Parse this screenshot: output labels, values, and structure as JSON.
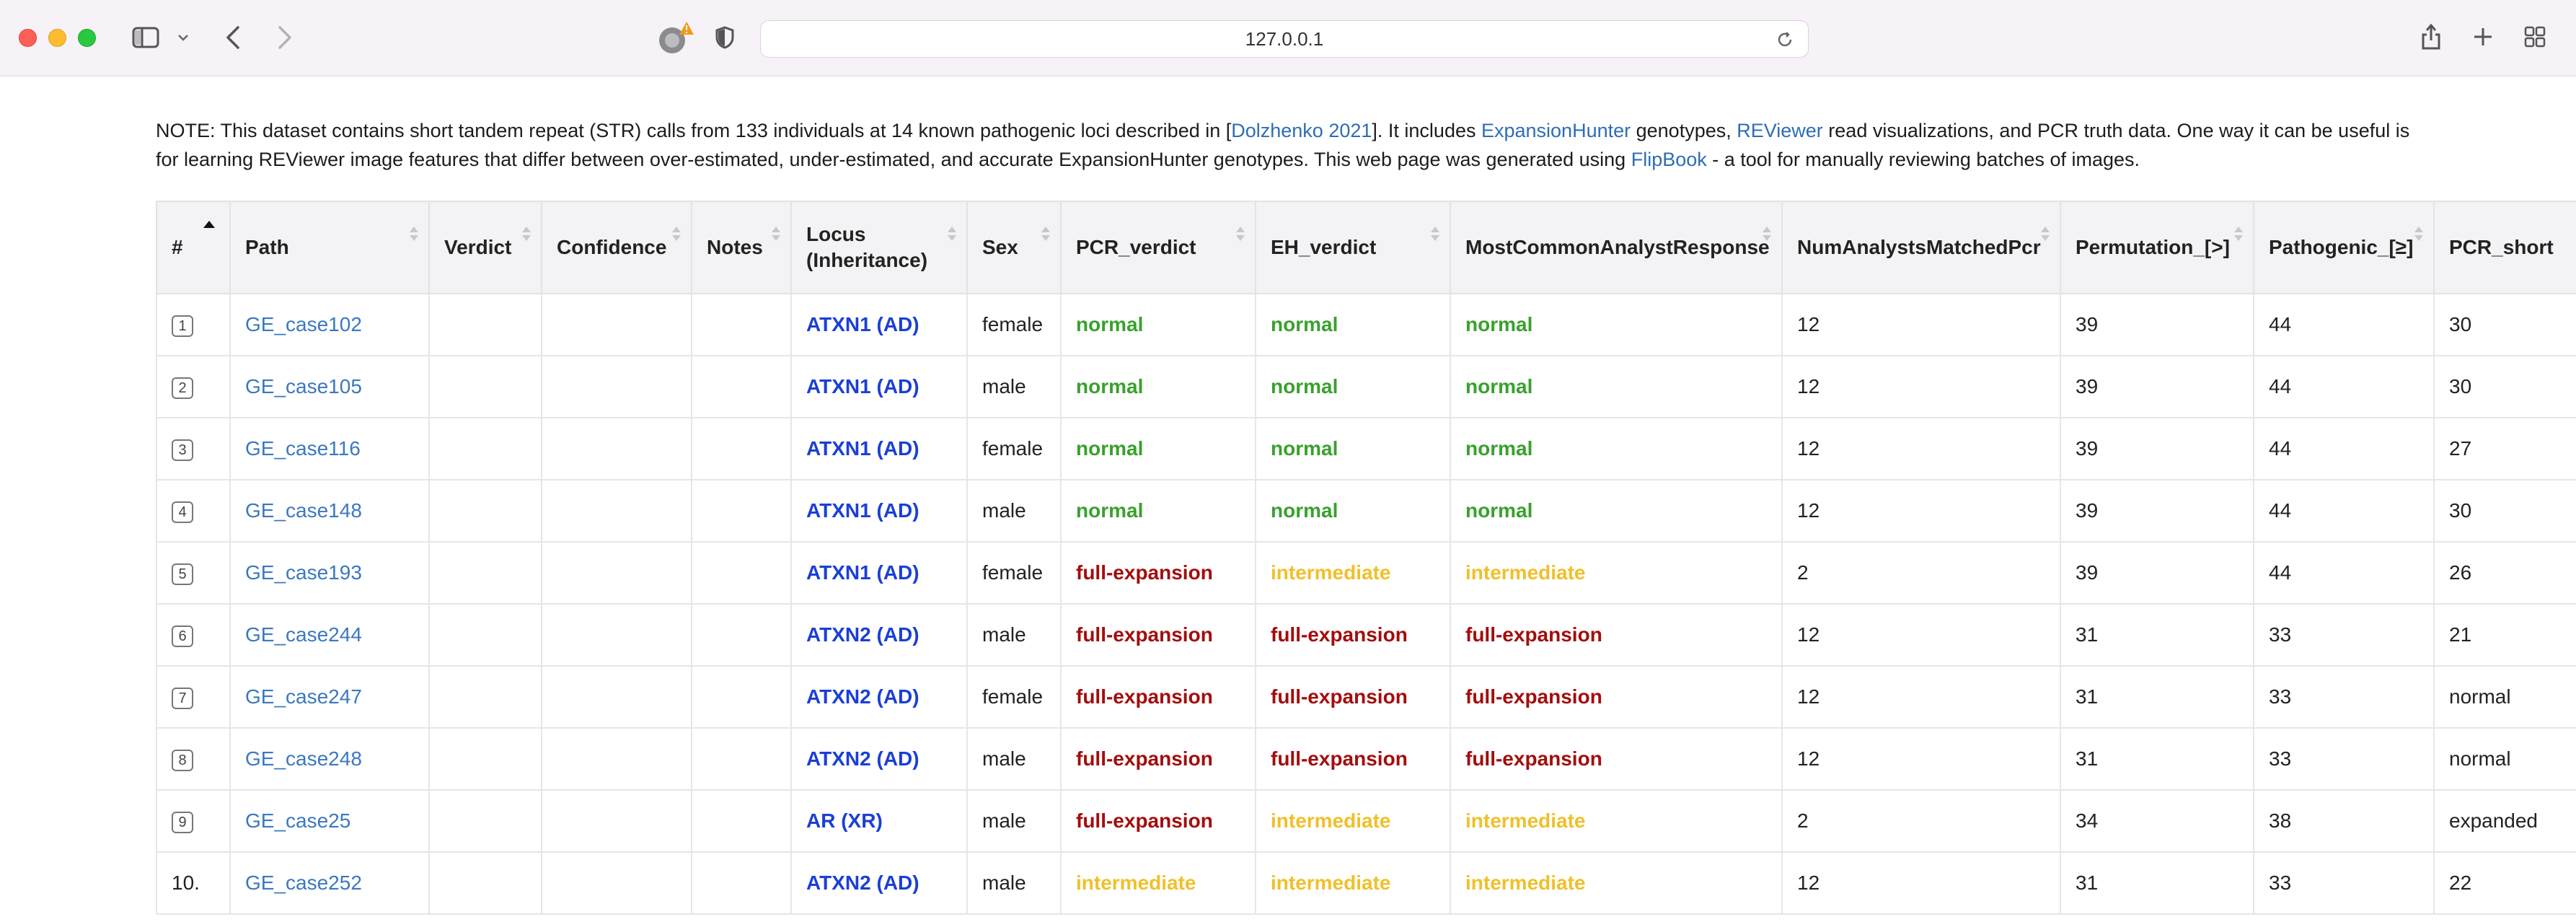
{
  "browser": {
    "url": "127.0.0.1"
  },
  "note": {
    "prefix": "NOTE: This dataset contains short tandem repeat (STR) calls from 133 individuals at 14 known pathogenic loci described in [",
    "link_dolzhenko": "Dolzhenko 2021",
    "mid1": "]. It includes ",
    "link_expansionhunter": "ExpansionHunter",
    "mid2": " genotypes, ",
    "link_reviewer": "REViewer",
    "mid3": " read visualizations, and PCR truth data. One way it can be useful is for learning REViewer image features that differ between over-estimated, under-estimated, and accurate ExpansionHunter genotypes. This web page was generated using ",
    "link_flipbook": "FlipBook",
    "suffix": " - a tool for manually reviewing batches of images."
  },
  "table": {
    "headers": [
      "#",
      "Path",
      "Verdict",
      "Confidence",
      "Notes",
      "Locus (Inheritance)",
      "Sex",
      "PCR_verdict",
      "EH_verdict",
      "MostCommonAnalystResponse",
      "NumAnalystsMatchedPcr",
      "Permutation_[>]",
      "Pathogenic_[≥]",
      "PCR_short"
    ],
    "rows": [
      {
        "num": "1",
        "path": "GE_case102",
        "verdict": "",
        "confidence": "",
        "notes": "",
        "locus": "ATXN1 (AD)",
        "sex": "female",
        "pcr_verdict": "normal",
        "eh_verdict": "normal",
        "analyst": "normal",
        "matched": "12",
        "permutation": "39",
        "pathogenic": "44",
        "pcr_short": "30"
      },
      {
        "num": "2",
        "path": "GE_case105",
        "verdict": "",
        "confidence": "",
        "notes": "",
        "locus": "ATXN1 (AD)",
        "sex": "male",
        "pcr_verdict": "normal",
        "eh_verdict": "normal",
        "analyst": "normal",
        "matched": "12",
        "permutation": "39",
        "pathogenic": "44",
        "pcr_short": "30"
      },
      {
        "num": "3",
        "path": "GE_case116",
        "verdict": "",
        "confidence": "",
        "notes": "",
        "locus": "ATXN1 (AD)",
        "sex": "female",
        "pcr_verdict": "normal",
        "eh_verdict": "normal",
        "analyst": "normal",
        "matched": "12",
        "permutation": "39",
        "pathogenic": "44",
        "pcr_short": "27"
      },
      {
        "num": "4",
        "path": "GE_case148",
        "verdict": "",
        "confidence": "",
        "notes": "",
        "locus": "ATXN1 (AD)",
        "sex": "male",
        "pcr_verdict": "normal",
        "eh_verdict": "normal",
        "analyst": "normal",
        "matched": "12",
        "permutation": "39",
        "pathogenic": "44",
        "pcr_short": "30"
      },
      {
        "num": "5",
        "path": "GE_case193",
        "verdict": "",
        "confidence": "",
        "notes": "",
        "locus": "ATXN1 (AD)",
        "sex": "female",
        "pcr_verdict": "full-expansion",
        "eh_verdict": "intermediate",
        "analyst": "intermediate",
        "matched": "2",
        "permutation": "39",
        "pathogenic": "44",
        "pcr_short": "26"
      },
      {
        "num": "6",
        "path": "GE_case244",
        "verdict": "",
        "confidence": "",
        "notes": "",
        "locus": "ATXN2 (AD)",
        "sex": "male",
        "pcr_verdict": "full-expansion",
        "eh_verdict": "full-expansion",
        "analyst": "full-expansion",
        "matched": "12",
        "permutation": "31",
        "pathogenic": "33",
        "pcr_short": "21"
      },
      {
        "num": "7",
        "path": "GE_case247",
        "verdict": "",
        "confidence": "",
        "notes": "",
        "locus": "ATXN2 (AD)",
        "sex": "female",
        "pcr_verdict": "full-expansion",
        "eh_verdict": "full-expansion",
        "analyst": "full-expansion",
        "matched": "12",
        "permutation": "31",
        "pathogenic": "33",
        "pcr_short": "normal"
      },
      {
        "num": "8",
        "path": "GE_case248",
        "verdict": "",
        "confidence": "",
        "notes": "",
        "locus": "ATXN2 (AD)",
        "sex": "male",
        "pcr_verdict": "full-expansion",
        "eh_verdict": "full-expansion",
        "analyst": "full-expansion",
        "matched": "12",
        "permutation": "31",
        "pathogenic": "33",
        "pcr_short": "normal"
      },
      {
        "num": "9",
        "path": "GE_case25",
        "verdict": "",
        "confidence": "",
        "notes": "",
        "locus": "AR (XR)",
        "sex": "male",
        "pcr_verdict": "full-expansion",
        "eh_verdict": "intermediate",
        "analyst": "intermediate",
        "matched": "2",
        "permutation": "34",
        "pathogenic": "38",
        "pcr_short": "expanded"
      },
      {
        "num": "10.",
        "path": "GE_case252",
        "verdict": "",
        "confidence": "",
        "notes": "",
        "locus": "ATXN2 (AD)",
        "sex": "male",
        "pcr_verdict": "intermediate",
        "eh_verdict": "intermediate",
        "analyst": "intermediate",
        "matched": "12",
        "permutation": "31",
        "pathogenic": "33",
        "pcr_short": "22"
      }
    ]
  },
  "colors": {
    "normal": "#39a12d",
    "full-expansion": "#a30d0d",
    "intermediate": "#f0c02a",
    "locus": "#1a3fd6",
    "link": "#3b78bf"
  }
}
